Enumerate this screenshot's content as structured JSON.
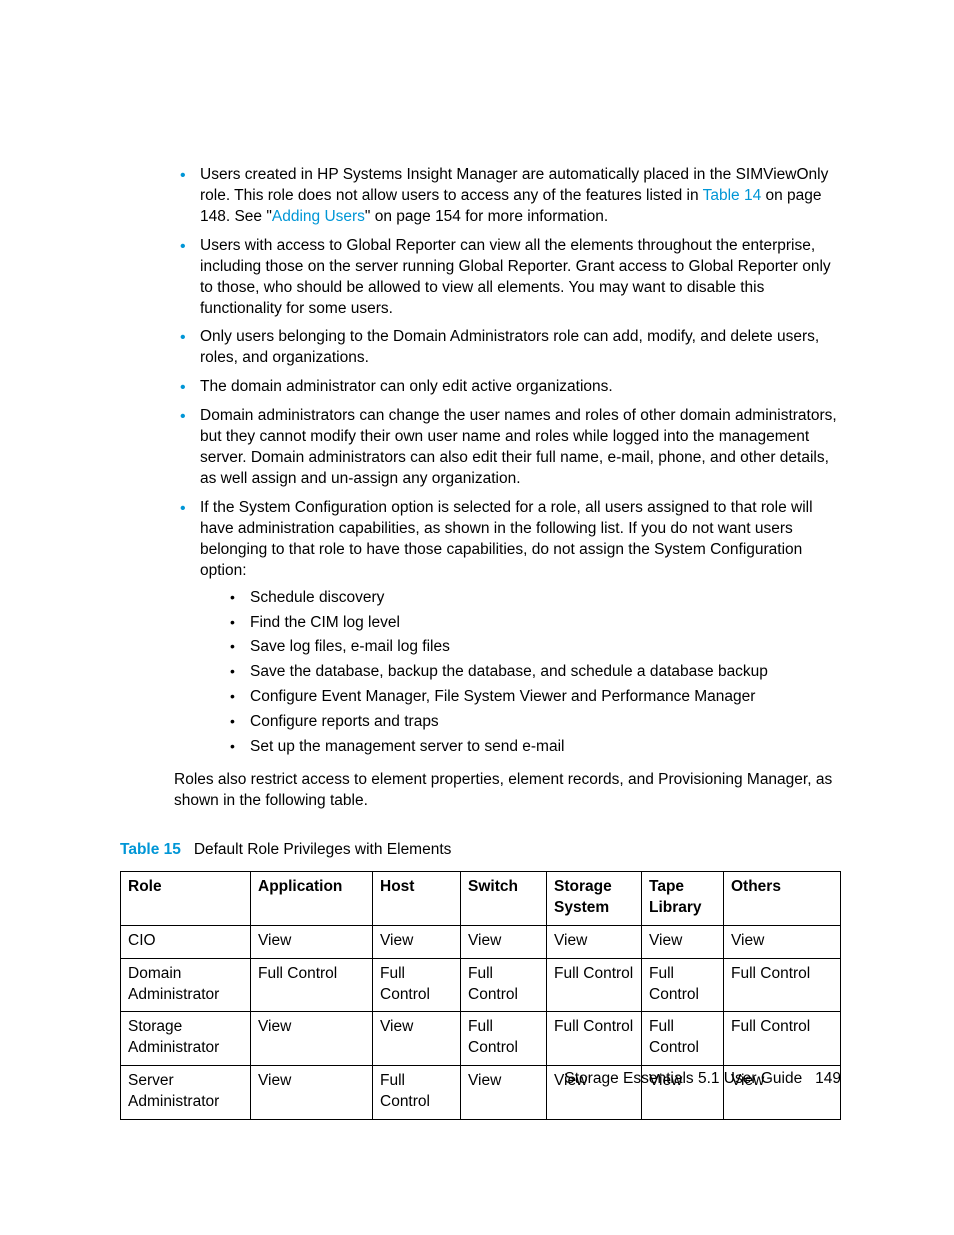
{
  "bullets": {
    "b1_pre": "Users created in HP Systems Insight Manager are automatically placed in the SIMViewOnly role. This role does not allow users to access any of the features listed in ",
    "b1_link1": "Table 14",
    "b1_mid": " on page 148. See \"",
    "b1_link2": "Adding Users",
    "b1_post": "\" on page 154 for more information.",
    "b2": "Users with access to Global Reporter can view all the elements throughout the enterprise, including those on the server running Global Reporter. Grant access to Global Reporter only to those, who should be allowed to view all elements.  You may want to disable this functionality for some users.",
    "b3": "Only users belonging to the Domain Administrators role can add, modify, and delete users, roles, and organizations.",
    "b4": "The domain administrator can only edit active organizations.",
    "b5": "Domain administrators can change the user names and roles of other domain administrators, but they cannot modify their own user name and roles while logged into the management server. Domain administrators can also edit their full name, e-mail, phone, and other details, as well assign and un-assign any organization.",
    "b6": "If the System Configuration option is selected for a role, all users assigned to that role will have administration capabilities, as shown in the following list. If you do not want users belonging to that role to have those capabilities, do not assign the System Configuration option:",
    "sub": [
      "Schedule discovery",
      "Find the CIM log level",
      "Save log files, e-mail log files",
      "Save the database, backup the database, and schedule a database backup",
      "Configure Event Manager, File System Viewer and Performance Manager",
      "Configure reports and traps",
      "Set up the management server to send e-mail"
    ]
  },
  "para": "Roles also restrict access to element properties, element records, and Provisioning Manager, as shown in the following table.",
  "table": {
    "caption_label": "Table 15",
    "caption_text": "Default Role Privileges with Elements",
    "headers": [
      "Role",
      "Application",
      "Host",
      "Switch",
      "Storage System",
      "Tape Library",
      "Others"
    ],
    "rows": [
      [
        "CIO",
        "View",
        "View",
        "View",
        "View",
        "View",
        "View"
      ],
      [
        "Domain Administrator",
        "Full Control",
        "Full Control",
        "Full Control",
        "Full Control",
        "Full Control",
        "Full Control"
      ],
      [
        "Storage Administrator",
        "View",
        "View",
        "Full Control",
        "Full Control",
        "Full Control",
        "Full Control"
      ],
      [
        "Server Administrator",
        "View",
        "Full Control",
        "View",
        "View",
        "View",
        "View"
      ]
    ]
  },
  "footer": {
    "text": "Storage Essentials 5.1 User Guide",
    "page": "149"
  }
}
